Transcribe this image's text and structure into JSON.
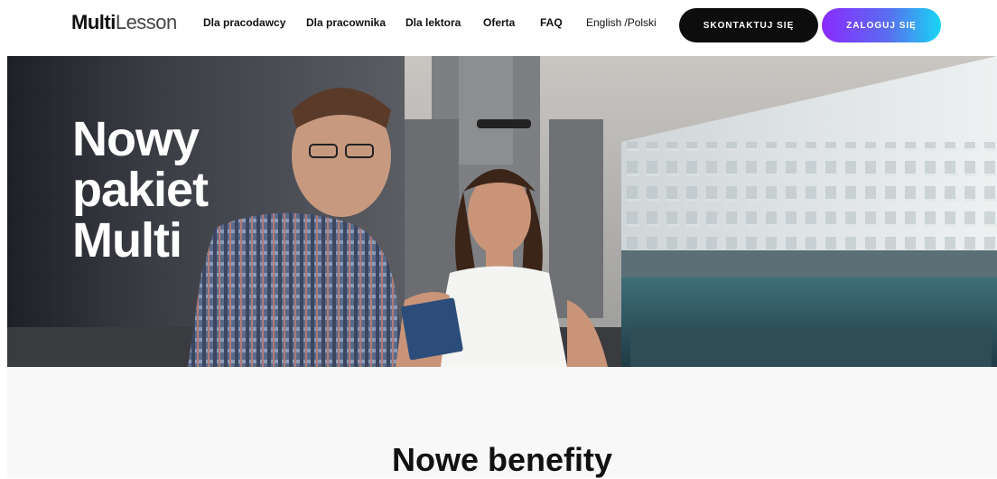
{
  "header": {
    "logo_bold": "Multi",
    "logo_light": "Lesson",
    "nav": [
      {
        "label": "Dla pracodawcy"
      },
      {
        "label": "Dla pracownika"
      },
      {
        "label": "Dla lektora"
      },
      {
        "label": "Oferta"
      },
      {
        "label": "FAQ"
      }
    ],
    "lang_en": "English",
    "lang_sep": "/",
    "lang_pl": "Polski",
    "contact_label": "SKONTAKTUJ SIĘ",
    "login_label": "ZALOGUJ SIĘ"
  },
  "hero": {
    "title_lines": [
      "Nowy",
      "pakiet",
      "Multi"
    ]
  },
  "section": {
    "title": "Nowe benefity"
  },
  "colors": {
    "button_dark": "#0d0d0d",
    "gradient_start": "#8a2bff",
    "gradient_end": "#18d6f2"
  }
}
